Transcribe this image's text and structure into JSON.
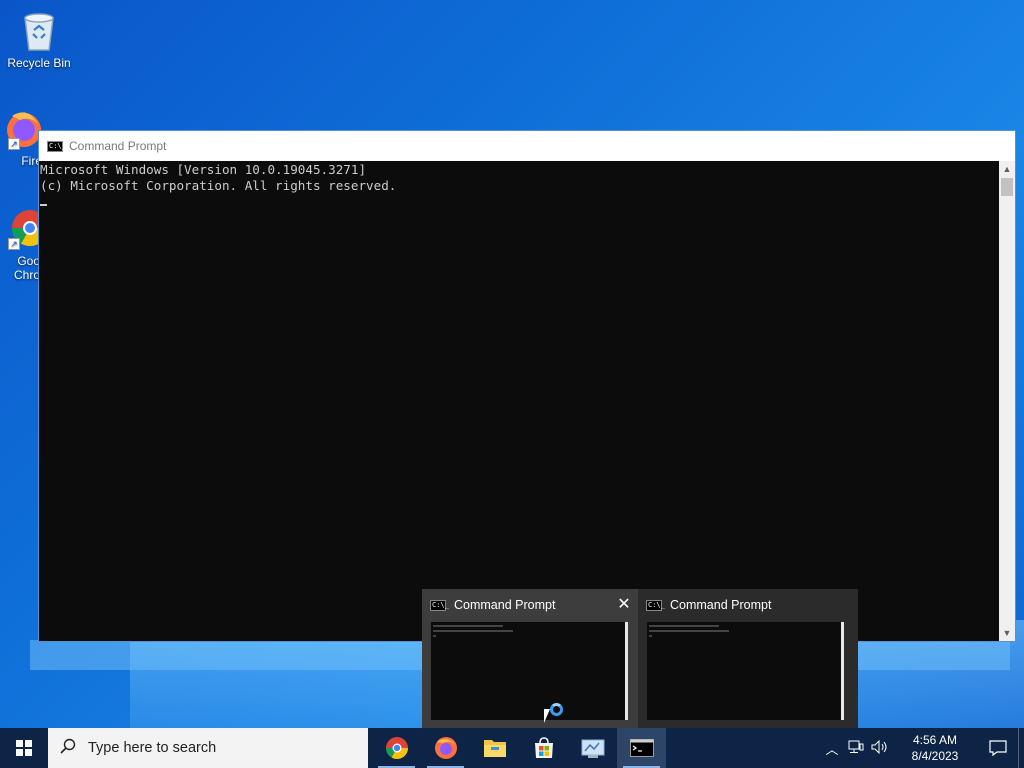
{
  "desktop": {
    "icons": [
      {
        "label": "Recycle Bin"
      },
      {
        "label": "Fire"
      },
      {
        "label": "Goo\nChro"
      }
    ]
  },
  "cmd": {
    "title": "Command Prompt",
    "icon_text": "C:\\_",
    "lines": [
      "Microsoft Windows [Version 10.0.19045.3271]",
      "(c) Microsoft Corporation. All rights reserved."
    ]
  },
  "thumbnails": [
    {
      "title": "Command Prompt"
    },
    {
      "title": "Command Prompt"
    }
  ],
  "taskbar": {
    "search_placeholder": "Type here to search",
    "apps": [
      "chrome-icon",
      "firefox-icon",
      "file-explorer-icon",
      "microsoft-store-icon",
      "control-panel-icon",
      "command-prompt-icon"
    ],
    "time": "4:56 AM",
    "date": "8/4/2023"
  },
  "colors": {
    "taskbar": "#0d2446",
    "accent": "#0f6fd8"
  }
}
